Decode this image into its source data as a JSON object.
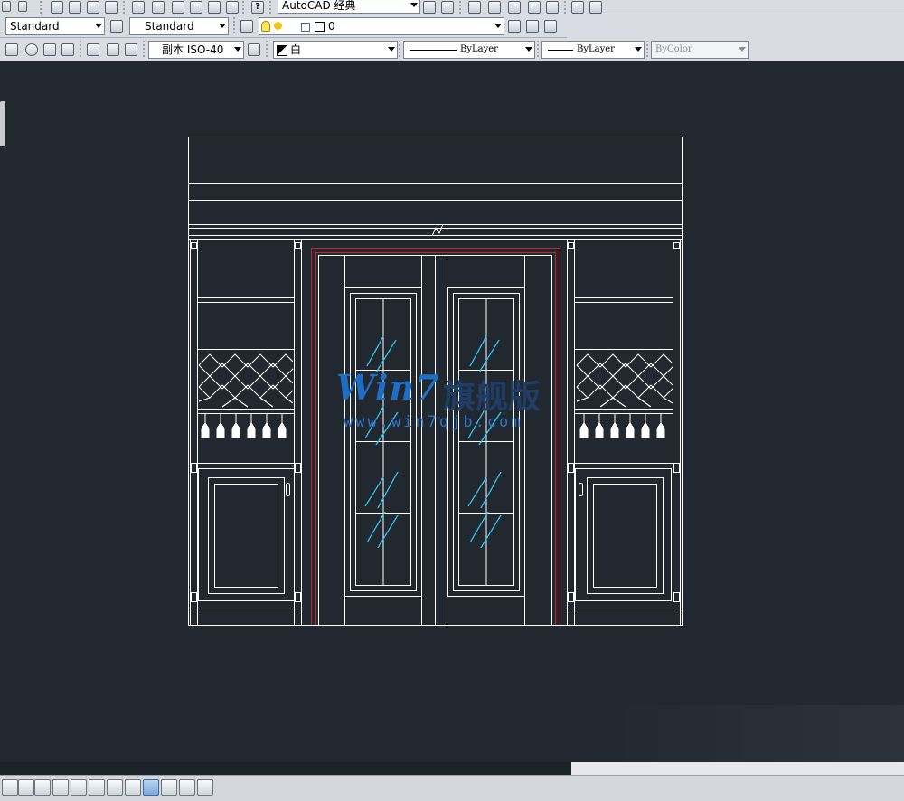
{
  "toolbar_row1": {
    "workspace_combo": "AutoCAD 经典",
    "help_glyph": "?"
  },
  "toolbar_row2": {
    "text_style_combo": "Standard",
    "table_style_combo": "Standard",
    "layer_combo": "0"
  },
  "toolbar_row3": {
    "dim_style_combo": "副本 ISO-40",
    "color_combo": "白",
    "linetype_combo": "ByLayer",
    "lineweight_combo": "ByLayer",
    "plotstyle_combo": "ByColor"
  },
  "watermark": {
    "brand": "Win7",
    "brand_cn": "旗舰版",
    "url": "www.win7qjb.com"
  },
  "colors": {
    "canvas": "#212830",
    "lines": "#ffffff",
    "door_frame": "#c0262a",
    "glass_hatch": "#2fc4ea"
  },
  "icons": {
    "row1": [
      "undo-icon",
      "redo-icon",
      "pan-icon",
      "zoom-realtime-icon",
      "zoom-window-icon",
      "zoom-previous-icon",
      "properties-icon",
      "design-center-icon",
      "tool-palettes-icon",
      "sheet-set-icon",
      "markup-icon",
      "calculator-icon",
      "help-icon",
      "workspace-settings-icon",
      "workspace-icon",
      "viewport-icon",
      "3d-orbit-icon",
      "layer-prev-icon",
      "view-icon",
      "render-icon",
      "ucs-icon"
    ],
    "status": [
      "snap-icon",
      "grid-icon",
      "ortho-icon",
      "polar-icon",
      "osnap-icon",
      "otrack-icon",
      "ducs-icon",
      "dyn-icon",
      "lwt-icon",
      "qp-icon",
      "sc-icon",
      "am-icon"
    ]
  }
}
